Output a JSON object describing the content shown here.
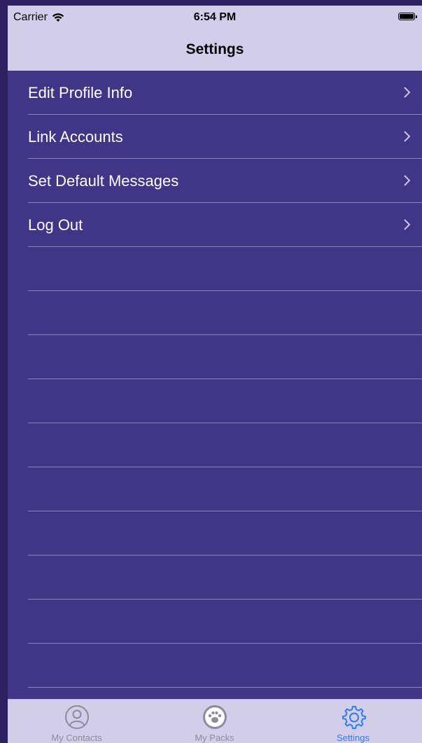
{
  "status_bar": {
    "carrier": "Carrier",
    "time": "6:54 PM",
    "wifi_icon": "wifi-icon",
    "battery_icon": "battery-icon"
  },
  "nav": {
    "title": "Settings"
  },
  "settings_list": {
    "items": [
      {
        "label": "Edit Profile Info"
      },
      {
        "label": "Link Accounts"
      },
      {
        "label": "Set Default Messages"
      },
      {
        "label": "Log Out"
      }
    ]
  },
  "tab_bar": {
    "tabs": [
      {
        "label": "My Contacts",
        "icon": "contacts-icon",
        "active": false
      },
      {
        "label": "My Packs",
        "icon": "paw-icon",
        "active": false
      },
      {
        "label": "Settings",
        "icon": "gear-icon",
        "active": true
      }
    ]
  },
  "colors": {
    "background": "#403586",
    "bar": "#d3cdec",
    "separator": "#8b84b8",
    "active_tab": "#2a7ff3",
    "inactive_tab": "#8e8a99"
  }
}
